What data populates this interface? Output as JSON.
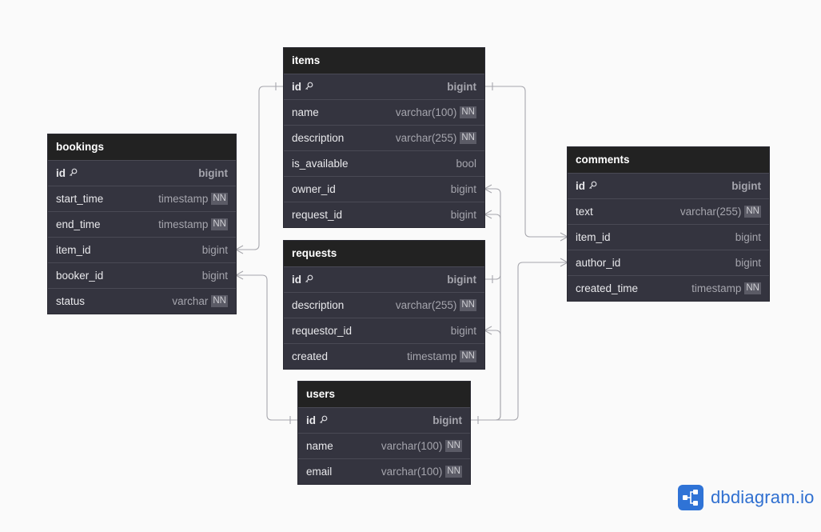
{
  "colors": {
    "background": "#fafafa",
    "table_header": "#222222",
    "table_body": "#34343f",
    "connector": "#a7a7ad",
    "brand": "#2f73d6"
  },
  "tables": [
    {
      "id": "items",
      "name": "items",
      "fields": [
        {
          "name": "id",
          "type": "bigint",
          "pk": true,
          "nn": false
        },
        {
          "name": "name",
          "type": "varchar(100)",
          "pk": false,
          "nn": true
        },
        {
          "name": "description",
          "type": "varchar(255)",
          "pk": false,
          "nn": true
        },
        {
          "name": "is_available",
          "type": "bool",
          "pk": false,
          "nn": false
        },
        {
          "name": "owner_id",
          "type": "bigint",
          "pk": false,
          "nn": false
        },
        {
          "name": "request_id",
          "type": "bigint",
          "pk": false,
          "nn": false
        }
      ]
    },
    {
      "id": "bookings",
      "name": "bookings",
      "fields": [
        {
          "name": "id",
          "type": "bigint",
          "pk": true,
          "nn": false
        },
        {
          "name": "start_time",
          "type": "timestamp",
          "pk": false,
          "nn": true
        },
        {
          "name": "end_time",
          "type": "timestamp",
          "pk": false,
          "nn": true
        },
        {
          "name": "item_id",
          "type": "bigint",
          "pk": false,
          "nn": false
        },
        {
          "name": "booker_id",
          "type": "bigint",
          "pk": false,
          "nn": false
        },
        {
          "name": "status",
          "type": "varchar",
          "pk": false,
          "nn": true
        }
      ]
    },
    {
      "id": "requests",
      "name": "requests",
      "fields": [
        {
          "name": "id",
          "type": "bigint",
          "pk": true,
          "nn": false
        },
        {
          "name": "description",
          "type": "varchar(255)",
          "pk": false,
          "nn": true
        },
        {
          "name": "requestor_id",
          "type": "bigint",
          "pk": false,
          "nn": false
        },
        {
          "name": "created",
          "type": "timestamp",
          "pk": false,
          "nn": true
        }
      ]
    },
    {
      "id": "users",
      "name": "users",
      "fields": [
        {
          "name": "id",
          "type": "bigint",
          "pk": true,
          "nn": false
        },
        {
          "name": "name",
          "type": "varchar(100)",
          "pk": false,
          "nn": true
        },
        {
          "name": "email",
          "type": "varchar(100)",
          "pk": false,
          "nn": true
        }
      ]
    },
    {
      "id": "comments",
      "name": "comments",
      "fields": [
        {
          "name": "id",
          "type": "bigint",
          "pk": true,
          "nn": false
        },
        {
          "name": "text",
          "type": "varchar(255)",
          "pk": false,
          "nn": true
        },
        {
          "name": "item_id",
          "type": "bigint",
          "pk": false,
          "nn": false
        },
        {
          "name": "author_id",
          "type": "bigint",
          "pk": false,
          "nn": false
        },
        {
          "name": "created_time",
          "type": "timestamp",
          "pk": false,
          "nn": true
        }
      ]
    }
  ],
  "nn_label": "NN",
  "relations": [
    {
      "from": "bookings.item_id",
      "to": "items.id"
    },
    {
      "from": "bookings.booker_id",
      "to": "users.id"
    },
    {
      "from": "items.owner_id",
      "to": "users.id"
    },
    {
      "from": "items.request_id",
      "to": "requests.id"
    },
    {
      "from": "requests.requestor_id",
      "to": "users.id"
    },
    {
      "from": "comments.item_id",
      "to": "items.id"
    },
    {
      "from": "comments.author_id",
      "to": "users.id"
    }
  ],
  "logo": {
    "text": "dbdiagram.io",
    "icon": "share-nodes-icon"
  }
}
